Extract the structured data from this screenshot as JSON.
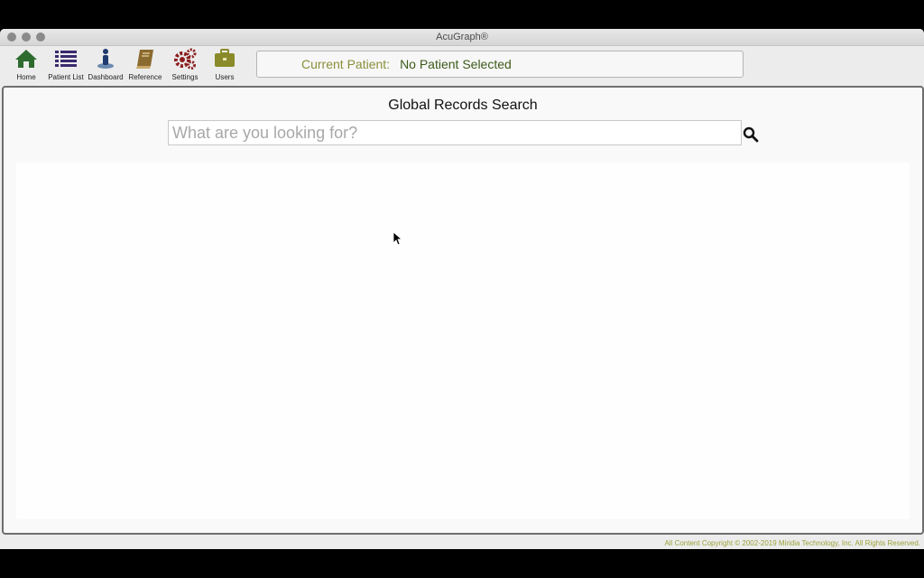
{
  "window": {
    "title": "AcuGraph®"
  },
  "toolbar": {
    "items": [
      {
        "label": "Home",
        "icon": "home-icon",
        "color": "#2e6b2e"
      },
      {
        "label": "Patient List",
        "icon": "list-icon",
        "color": "#3a2a6e"
      },
      {
        "label": "Dashboard",
        "icon": "dashboard-icon",
        "color": "#1e3a6e"
      },
      {
        "label": "Reference",
        "icon": "book-icon",
        "color": "#7a5a1e"
      },
      {
        "label": "Settings",
        "icon": "gears-icon",
        "color": "#8a1e1e"
      },
      {
        "label": "Users",
        "icon": "briefcase-icon",
        "color": "#8a8a2a"
      }
    ]
  },
  "patient": {
    "label": "Current Patient:",
    "value": "No Patient Selected"
  },
  "search": {
    "title": "Global Records Search",
    "placeholder": "What are you looking for?",
    "value": ""
  },
  "footer": {
    "copyright": "All Content Copyright © 2002-2019 Miridia Technology, Inc.  All Rights Reserved."
  }
}
